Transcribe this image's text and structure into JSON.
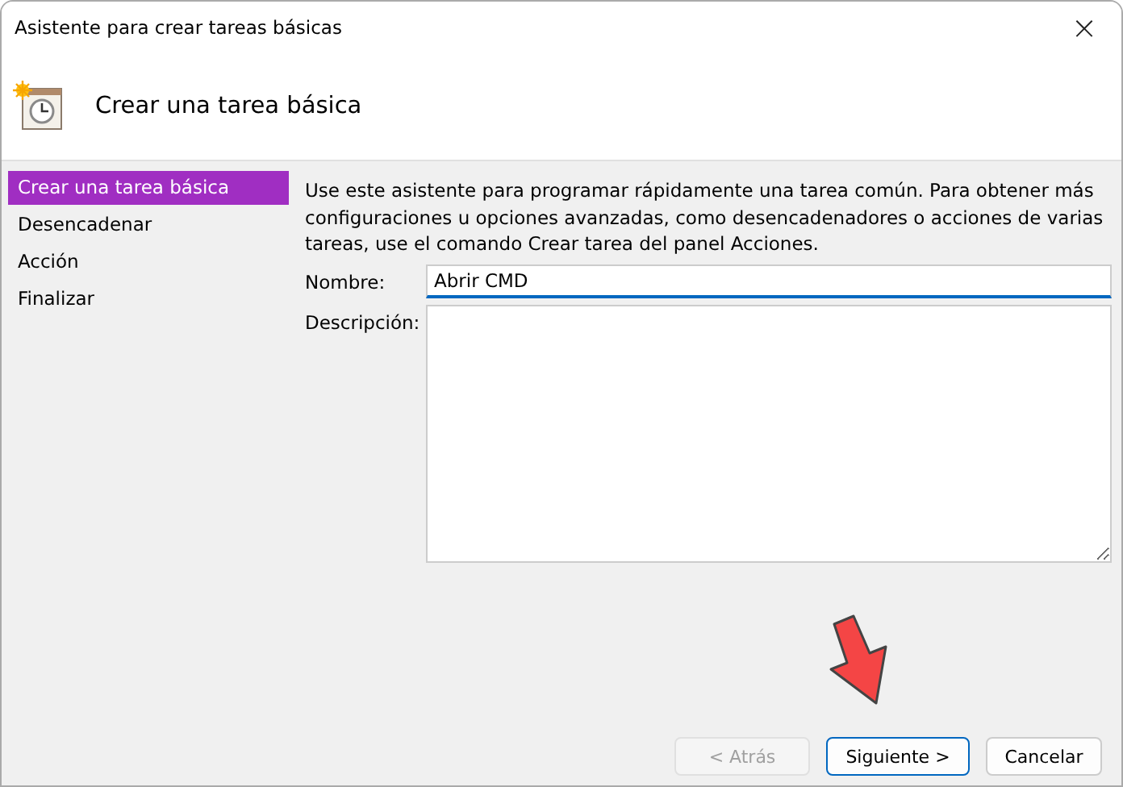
{
  "window": {
    "title": "Asistente para crear tareas básicas",
    "close": "×"
  },
  "header": {
    "title": "Crear una tarea básica"
  },
  "sidebar": {
    "items": [
      {
        "label": "Crear una tarea básica",
        "selected": true
      },
      {
        "label": "Desencadenar",
        "selected": false
      },
      {
        "label": "Acción",
        "selected": false
      },
      {
        "label": "Finalizar",
        "selected": false
      }
    ]
  },
  "intro": "Use este asistente para programar rápidamente una tarea común. Para obtener más configuraciones u opciones avanzadas, como desencadenadores o acciones de varias tareas, use el comando Crear tarea del panel Acciones.",
  "fields": [
    {
      "label": "Nombre:",
      "value": "Abrir CMD",
      "kind": "line",
      "focused": true
    },
    {
      "label": "Descripción:",
      "kind": "area",
      "focused": false
    }
  ],
  "buttons": [
    {
      "label": "< Atrás",
      "disabled": true,
      "default": false
    },
    {
      "label": "Siguiente >",
      "disabled": false,
      "default": true
    },
    {
      "label": "Cancelar",
      "disabled": false,
      "default": false
    }
  ]
}
